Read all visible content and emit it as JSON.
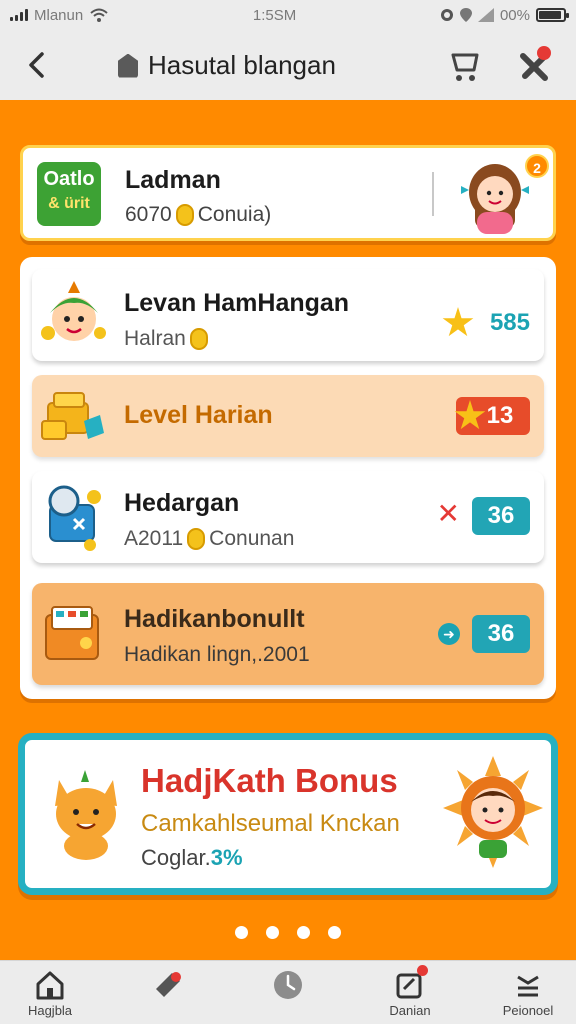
{
  "status_bar": {
    "carrier": "Mlanun",
    "time": "1:5SM",
    "battery": "00%",
    "battery_level": 0.9,
    "signal_icon": "signal-icon",
    "wifi_icon": "wifi-icon"
  },
  "nav": {
    "title": "Hasutal blangan",
    "back_icon": "back-arrow-icon",
    "cart_icon": "cart-icon",
    "tools_icon": "tools-icon"
  },
  "top_card": {
    "logo_line1": "Oatlo",
    "logo_line2": "& ürit",
    "title": "Ladman",
    "sub_prefix": "6070",
    "sub_suffix": "Conuia)",
    "badge": "2"
  },
  "rows": [
    {
      "title": "Levan HamHangan",
      "sub": "Halran",
      "value": "585",
      "style": "white",
      "icon": "mascot-icon",
      "marker": "star-icon"
    },
    {
      "title": "Level Harian",
      "value": "13",
      "style": "peach",
      "icon": "treasure-icon",
      "marker": "star-icon"
    },
    {
      "title": "Hedargan",
      "sub_prefix": "A2011",
      "sub_suffix": "Conunan",
      "value": "36",
      "style": "white",
      "icon": "robot-icon",
      "marker": "close-icon",
      "marker_glyph": "✕"
    },
    {
      "title": "Hadikanbonullt",
      "sub": "Hadikan lingn,.2001",
      "value": "36",
      "style": "orange",
      "icon": "wallet-icon",
      "marker": "arrow-icon",
      "marker_glyph": "➜"
    }
  ],
  "bonus": {
    "title": "HadjKath Bonus",
    "subtitle": "Camkahlseumal Knckan",
    "count_label": "Coglar.",
    "count_value": "3%"
  },
  "pager": {
    "pages": 4
  },
  "tabbar": {
    "tabs": [
      {
        "label": "Hagjbla",
        "icon": "home-icon"
      },
      {
        "label": "",
        "icon": "flashlight-icon"
      },
      {
        "label": "",
        "icon": "clock-icon"
      },
      {
        "label": "Danian",
        "icon": "note-icon"
      },
      {
        "label": "Peionoel",
        "icon": "menu-icon"
      }
    ]
  },
  "colors": {
    "background": "#ff8a00",
    "accent_teal": "#22a5b5",
    "accent_red": "#e74c2a",
    "accent_yellow": "#ffd24d",
    "bonus_title": "#d9342b"
  }
}
